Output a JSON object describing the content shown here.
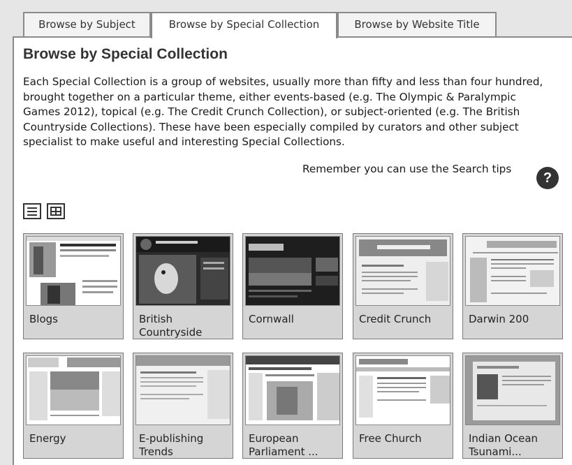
{
  "tabs": [
    {
      "label": "Browse by Subject",
      "active": false
    },
    {
      "label": "Browse by Special Collection",
      "active": true
    },
    {
      "label": "Browse by Website Title",
      "active": false
    }
  ],
  "heading": "Browse by Special Collection",
  "intro": "Each Special Collection is a group of websites, usually more than fifty and less than four hundred, brought together on a particular theme, either events-based (e.g. The Olympic & Paralympic Games 2012), topical (e.g. The Credit Crunch Collection), or subject-oriented (e.g. The British Countryside Collections). These have been especially compiled by curators and other subject specialist to make useful and interesting Special Collections.",
  "search_tips": "Remember you can use the Search tips",
  "help_icon": "?",
  "view_toggles": [
    "list-view-icon",
    "grid-view-icon"
  ],
  "collections": [
    {
      "label": "Blogs"
    },
    {
      "label": "British Countryside"
    },
    {
      "label": "Cornwall"
    },
    {
      "label": "Credit Crunch"
    },
    {
      "label": "Darwin 200"
    },
    {
      "label": "Energy"
    },
    {
      "label": "E-publishing Trends"
    },
    {
      "label": "European Parliament ..."
    },
    {
      "label": "Free Church"
    },
    {
      "label": "Indian Ocean Tsunami..."
    }
  ],
  "colors": {
    "page_bg": "#e6e6e6",
    "panel_bg": "#ffffff",
    "card_bg": "#d5d5d5",
    "border": "#8a8a8a"
  }
}
